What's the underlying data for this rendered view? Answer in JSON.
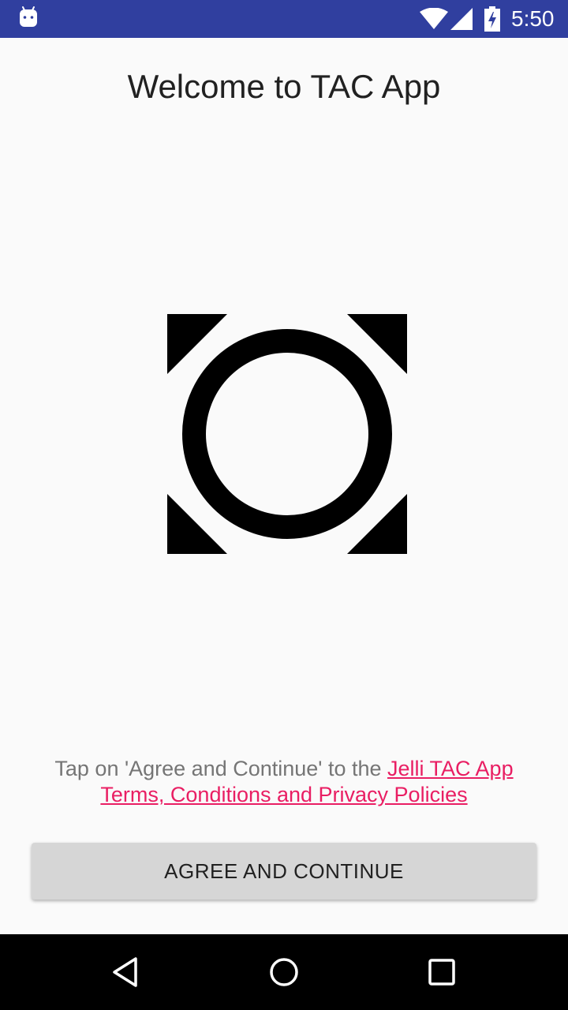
{
  "status_bar": {
    "time": "5:50",
    "icons": [
      "android-icon",
      "wifi-icon",
      "signal-icon",
      "battery-charging-icon"
    ],
    "background": "#303f9f"
  },
  "welcome": {
    "title": "Welcome to TAC App"
  },
  "logo": {
    "icon": "tac-logo-icon"
  },
  "terms": {
    "prefix": "Tap on 'Agree and Continue' to the ",
    "link_text": "Jelli TAC App Terms, Conditions and Privacy Policies",
    "link_color": "#e91e63"
  },
  "agree_button": {
    "label": "AGREE AND CONTINUE"
  },
  "nav_bar": {
    "icons": [
      "back-icon",
      "home-icon",
      "recents-icon"
    ]
  },
  "colors": {
    "background": "#fafafa",
    "button": "#d6d6d6",
    "text_primary": "#212121",
    "text_secondary": "#757575"
  }
}
